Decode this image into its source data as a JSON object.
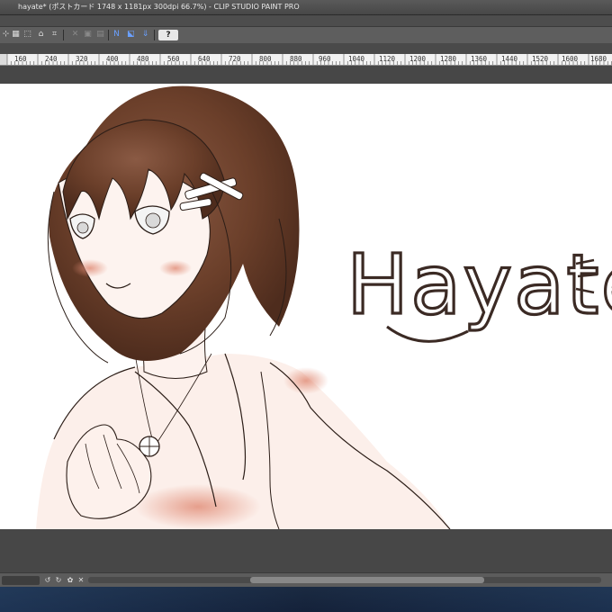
{
  "window": {
    "title": "hayate* (ポストカード 1748 x 1181px 300dpi 66.7%)  - CLIP STUDIO PAINT PRO"
  },
  "toolbar": {
    "icons": [
      "transform-icon",
      "select-all-icon",
      "fill-icon",
      "clear-selection-icon",
      "crop-icon",
      "undo-icon",
      "redo-icon",
      "snap-ruler-icon",
      "snap-grid-icon",
      "snap-vector-icon",
      "help-icon"
    ],
    "help_label": "?"
  },
  "ruler": {
    "ticks": [
      "160",
      "240",
      "320",
      "400",
      "480",
      "560",
      "640",
      "720",
      "800",
      "880",
      "960",
      "1040",
      "1120",
      "1200",
      "1280",
      "1360",
      "1440",
      "1520",
      "1600",
      "1680"
    ]
  },
  "canvas": {
    "lettering": "Hayate"
  },
  "colors": {
    "hair": "#6b3f2a",
    "lineart": "#2b1d17",
    "blush": "#d9826a",
    "lettering": "#3b2a24"
  }
}
